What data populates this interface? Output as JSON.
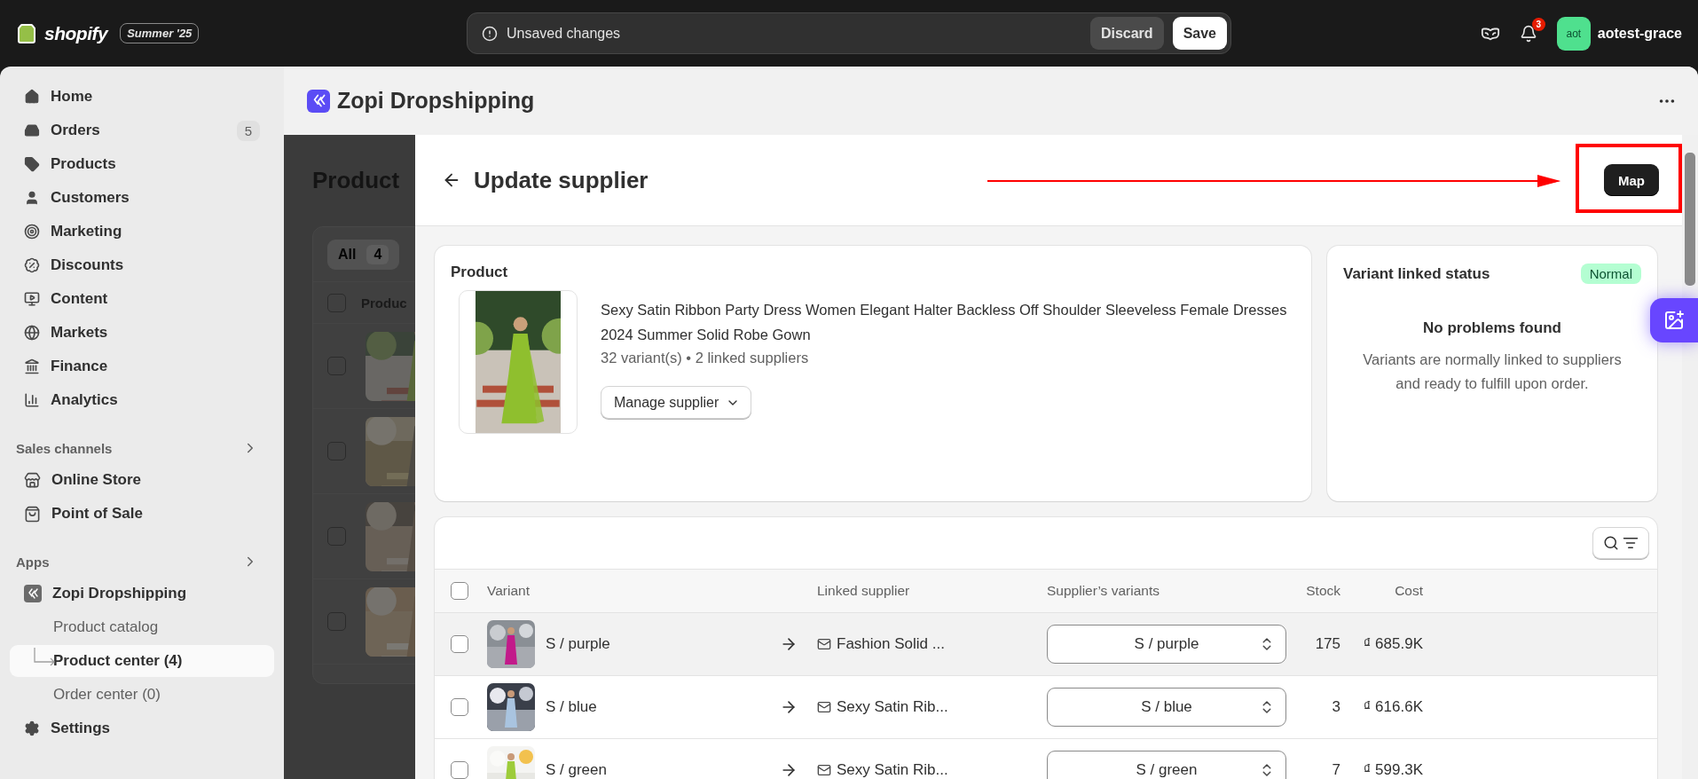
{
  "top_bar": {
    "logo": "shopify",
    "edition": "Summer '25",
    "notice": {
      "message": "Unsaved changes",
      "discard": "Discard",
      "save": "Save"
    },
    "notifications": "3",
    "avatar": "aot",
    "store": "aotest-grace"
  },
  "sidebar": {
    "items": [
      {
        "label": "Home",
        "selected": false
      },
      {
        "label": "Orders",
        "badge": "5",
        "selected": false
      },
      {
        "label": "Products",
        "selected": false
      },
      {
        "label": "Customers",
        "selected": false
      },
      {
        "label": "Marketing",
        "selected": false
      },
      {
        "label": "Discounts",
        "selected": false
      },
      {
        "label": "Content",
        "selected": false
      },
      {
        "label": "Markets",
        "selected": false
      },
      {
        "label": "Finance",
        "selected": false
      },
      {
        "label": "Analytics",
        "selected": false
      }
    ],
    "sections": [
      {
        "title": "Sales channels",
        "items": [
          {
            "label": "Online Store",
            "selected": false
          },
          {
            "label": "Point of Sale",
            "selected": false
          }
        ]
      },
      {
        "title": "Apps",
        "items": [
          {
            "label": "Zopi Dropshipping",
            "selected": false,
            "children": [
              {
                "label": "Product catalog",
                "selected": false
              },
              {
                "label": "Product center (4)",
                "selected": true
              },
              {
                "label": "Order center (0)",
                "selected": false
              }
            ]
          }
        ]
      }
    ],
    "footer_items": [
      {
        "label": "Settings",
        "selected": false
      }
    ]
  },
  "app_header": {
    "title": "Zopi Dropshipping"
  },
  "background_page": {
    "title": "Product",
    "tab": {
      "label": "All",
      "count": "4"
    },
    "all_checked": false,
    "column": "Produc",
    "rows": [
      {
        "checked": false
      },
      {
        "checked": false
      },
      {
        "checked": false
      },
      {
        "checked": false
      }
    ]
  },
  "modal": {
    "title": "Update supplier",
    "action": "Map",
    "product_card": {
      "heading": "Product",
      "name": "Sexy Satin Ribbon Party Dress Women Elegant Halter Backless Off Shoulder Sleeveless Female Dresses 2024 Summer Solid Robe Gown",
      "meta": "32 variant(s) • 2 linked suppliers",
      "button": "Manage supplier"
    },
    "status_card": {
      "heading": "Variant linked status",
      "badge": "Normal",
      "title": "No problems found",
      "description": "Variants are normally linked to suppliers and ready to fulfill upon order."
    },
    "variants_table": {
      "all_checked": false,
      "columns": [
        "Variant",
        "Linked supplier",
        "Supplier’s variants",
        "Stock",
        "Cost"
      ],
      "rows": [
        {
          "checked": false,
          "highlighted": true,
          "variant": "S / purple",
          "supplier": "Fashion Solid ...",
          "supplier_variant": "S / purple",
          "stock": "175",
          "cost": "₫ 685.9K"
        },
        {
          "checked": false,
          "highlighted": false,
          "variant": "S / blue",
          "supplier": "Sexy Satin Rib...",
          "supplier_variant": "S / blue",
          "stock": "3",
          "cost": "₫ 616.6K"
        },
        {
          "checked": false,
          "highlighted": false,
          "variant": "S / green",
          "supplier": "Sexy Satin Rib...",
          "supplier_variant": "S / green",
          "stock": "7",
          "cost": "₫ 599.3K"
        }
      ]
    }
  }
}
